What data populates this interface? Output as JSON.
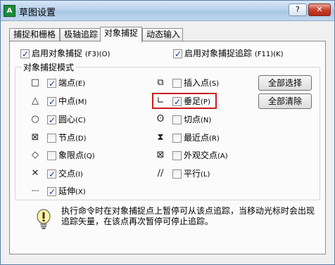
{
  "window": {
    "title": "草图设置",
    "app_icon_text": "A",
    "help_label": "?",
    "close_label": "✕"
  },
  "tabs": [
    {
      "label": "捕捉和栅格",
      "active": false
    },
    {
      "label": "极轴追踪",
      "active": false
    },
    {
      "label": "对象捕捉",
      "active": true
    },
    {
      "label": "动态输入",
      "active": false
    }
  ],
  "top_options": {
    "enable_osnap": {
      "label": "启用对象捕捉",
      "key": "(F3)(O)",
      "checked": true
    },
    "enable_tracking": {
      "label": "启用对象捕捉追踪",
      "key": "(F11)(K)",
      "checked": true
    }
  },
  "group": {
    "title": "对象捕捉模式",
    "left": [
      {
        "symbol": "□",
        "label": "端点",
        "key": "(E)",
        "checked": true
      },
      {
        "symbol": "△",
        "label": "中点",
        "key": "(M)",
        "checked": true
      },
      {
        "symbol": "○",
        "label": "圆心",
        "key": "(C)",
        "checked": true
      },
      {
        "symbol": "⊠",
        "label": "节点",
        "key": "(D)",
        "checked": false
      },
      {
        "symbol": "◇",
        "label": "象限点",
        "key": "(Q)",
        "checked": false
      },
      {
        "symbol": "✕",
        "label": "交点",
        "key": "(I)",
        "checked": true
      },
      {
        "symbol": "---",
        "label": "延伸",
        "key": "(X)",
        "checked": true
      }
    ],
    "right": [
      {
        "symbol": "⧉",
        "label": "插入点",
        "key": "(S)",
        "checked": false
      },
      {
        "symbol": "∟",
        "label": "垂足",
        "key": "(P)",
        "checked": true
      },
      {
        "symbol": "ʘ",
        "label": "切点",
        "key": "(N)",
        "checked": false
      },
      {
        "symbol": "⧗",
        "label": "最近点",
        "key": "(R)",
        "checked": false
      },
      {
        "symbol": "⊠",
        "label": "外观交点",
        "key": "(A)",
        "checked": false
      },
      {
        "symbol": "∕∕",
        "label": "平行",
        "key": "(L)",
        "checked": false
      }
    ],
    "select_all": "全部选择",
    "clear_all": "全部清除"
  },
  "note": {
    "icon": "lightbulb-icon",
    "text": "执行命令时在对象捕捉点上暂停可从该点追踪，当移动光标时会出现追踪矢量，在该点再次暂停可停止追踪。"
  },
  "colors": {
    "highlight": "#c81e1e",
    "title_bar": "#b9d1ea"
  }
}
